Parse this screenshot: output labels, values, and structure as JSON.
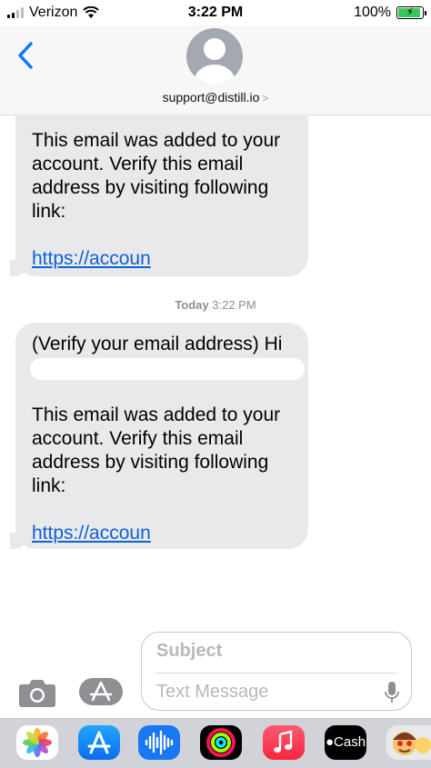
{
  "status_bar": {
    "carrier": "Verizon",
    "time": "3:22 PM",
    "battery": "100%",
    "battery_level": 1.0
  },
  "header": {
    "contact": "support@distill.io",
    "contact_chevron": ">"
  },
  "messages": [
    {
      "lines": [
        "This email was added to your",
        "account. Verify this email",
        "address by visiting following",
        "link:"
      ],
      "link": "https://accoun"
    },
    {
      "timestamp_day": "Today",
      "timestamp_time": "3:22 PM",
      "first_line": "(Verify your email address) Hi",
      "lines": [
        "This email was added to your",
        "account. Verify this email",
        "address by visiting following",
        "link:"
      ],
      "link": "https://accoun"
    }
  ],
  "compose": {
    "subject_placeholder": "Subject",
    "message_placeholder": "Text Message"
  },
  "app_drawer": {
    "cash_label": "Cash"
  },
  "colors": {
    "bubble": "#e9e9eb",
    "link": "#0a62d6",
    "accent": "#0a7aff"
  }
}
